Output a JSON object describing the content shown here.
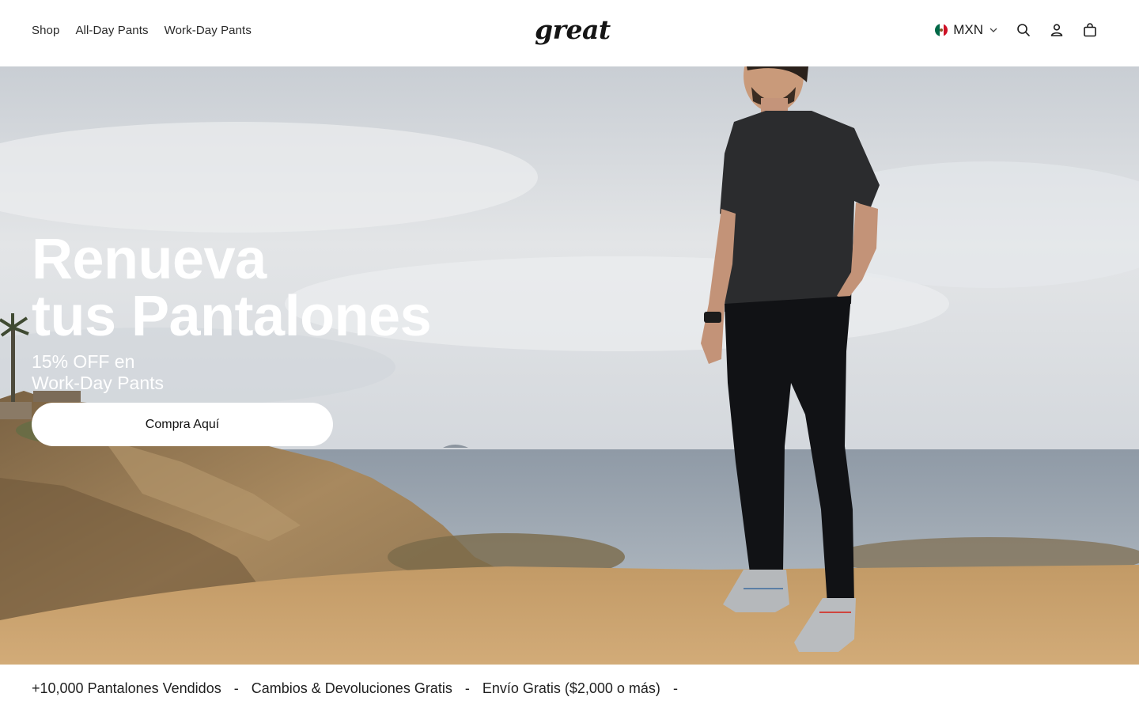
{
  "header": {
    "nav": [
      "Shop",
      "All-Day Pants",
      "Work-Day Pants"
    ],
    "logo": "great",
    "currency": {
      "label": "MXN",
      "flag_colors": [
        "#006847",
        "#ffffff",
        "#ce1126"
      ]
    },
    "icons": [
      "search-icon",
      "account-icon",
      "cart-icon"
    ]
  },
  "hero": {
    "title_line1": "Renueva",
    "title_line2": "tus Pantalones",
    "subtitle_line1": "15% OFF en",
    "subtitle_line2": "Work-Day Pants",
    "cta_label": "Compra Aquí"
  },
  "marquee": {
    "items": [
      "+10,000 Pantalones Vendidos",
      "Cambios & Devoluciones Gratis",
      "Envío Gratis ($2,000 o más)"
    ],
    "separator": "-"
  },
  "colors": {
    "text": "#111111",
    "hero_text": "#ffffff",
    "sky": "#d9dce0",
    "sea": "#9ca7b2",
    "sand": "#c59f6e"
  }
}
